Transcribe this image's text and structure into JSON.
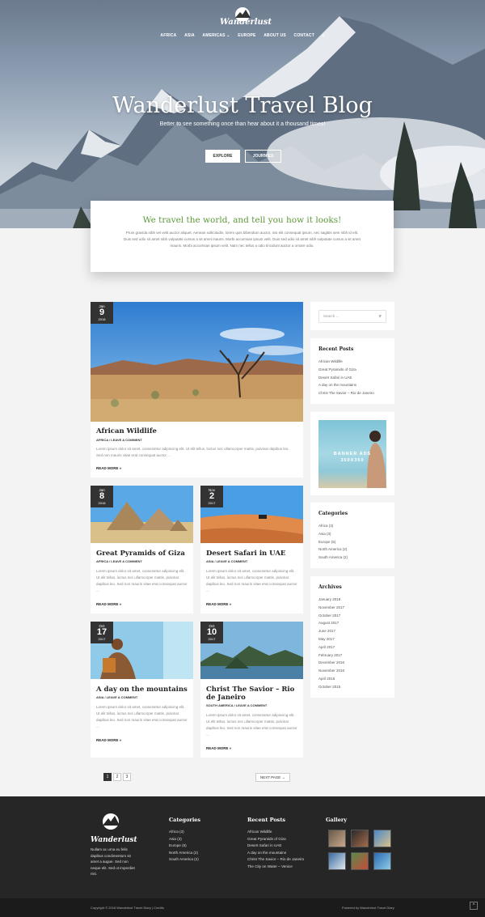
{
  "header": {
    "logo_text": "Wanderlust",
    "nav": [
      "AFRICA",
      "ASIA",
      "AMERICAS",
      "EUROPE",
      "ABOUT US",
      "CONTACT"
    ],
    "hero_title": "Wanderlust Travel Blog",
    "hero_subtitle": "Better to see something once than hear about it a thousand times!",
    "btn_explore": "EXPLORE",
    "btn_journeys": "JOURNIES"
  },
  "intro": {
    "title": "We travel the world, and tell you how it looks!",
    "text": "Proin gravida nibh vel velit auctor aliquet. Aenean sollicitudin, lorem quis bibendum auctor, nisi elit consequat ipsum, nec sagittis sem nibh id elit. Duis sed odio sit amet nibh vulputate cursus a sit amet mauris. Morbi accumsan ipsum velit. Duis sed odio sit amet nibh vulputate cursus a sit amet mauris. Morbi accumsan ipsum velit. Nam nec tellus a odio tincidunt auctor a ornare odio."
  },
  "posts": [
    {
      "month": "Jan",
      "day": "9",
      "year": "2018",
      "title": "African Wildlife",
      "meta": "AFRICA / LEAVE A COMMENT",
      "excerpt": "Lorem ipsum dolor sit amet, consectetur adipiscing elit. Ut elit tellus, luctus nec ullamcorper mattis, pulvinar dapibus leo. Sed non mauris vitae erat consequat auctor ...",
      "more": "READ MORE »"
    },
    {
      "month": "Jan",
      "day": "8",
      "year": "2018",
      "title": "Great Pyramids of Giza",
      "meta": "AFRICA / LEAVE A COMMENT",
      "excerpt": "Lorem ipsum dolor sit amet, consectetur adipiscing elit. Ut elit tellus, luctus nec ullamcorper mattis, pulvinar dapibus leo. Sed non mauris vitae erat consequat auctor ...",
      "more": "READ MORE »"
    },
    {
      "month": "Nov",
      "day": "2",
      "year": "2017",
      "title": "Desert Safari in UAE",
      "meta": "ASIA / LEAVE A COMMENT",
      "excerpt": "Lorem ipsum dolor sit amet, consectetur adipiscing elit. Ut elit tellus, luctus nec ullamcorper mattis, pulvinar dapibus leo. Sed non mauris vitae erat consequat auctor ...",
      "more": "READ MORE »"
    },
    {
      "month": "Oct",
      "day": "17",
      "year": "2017",
      "title": "A day on the mountains",
      "meta": "ASIA / LEAVE A COMMENT",
      "excerpt": "Lorem ipsum dolor sit amet, consectetur adipiscing elit. Ut elit tellus, luctus nec ullamcorper mattis, pulvinar dapibus leo. Sed non mauris vitae erat consequat auctor ...",
      "more": "READ MORE »"
    },
    {
      "month": "Oct",
      "day": "10",
      "year": "2017",
      "title": "Christ The Savior – Rio de Janeiro",
      "meta": "SOUTH AMERICA / LEAVE A COMMENT",
      "excerpt": "Lorem ipsum dolor sit amet, consectetur adipiscing elit. Ut elit tellus, luctus nec ullamcorper mattis, pulvinar dapibus leo. Sed non mauris vitae erat consequat auctor ...",
      "more": "READ MORE »"
    }
  ],
  "sidebar": {
    "search_placeholder": "Search ...",
    "recent_title": "Recent Posts",
    "recent": [
      "African Wildlife",
      "Great Pyramids of Giza",
      "Desert Safari in UAE",
      "A day on the mountains",
      "Christ The Savior – Rio de Janeiro"
    ],
    "banner_text": "BANNER ADS",
    "banner_size": "350X350",
    "categories_title": "Categories",
    "categories": [
      "Africa (3)",
      "Asia (3)",
      "Europe (5)",
      "North America (2)",
      "South America (2)"
    ],
    "archives_title": "Archives",
    "archives": [
      "January 2018",
      "November 2017",
      "October 2017",
      "August 2017",
      "June 2017",
      "May 2017",
      "April 2017",
      "February 2017",
      "December 2016",
      "November 2016",
      "April 2016",
      "October 2015"
    ]
  },
  "pagination": {
    "pages": [
      "1",
      "2",
      "3"
    ],
    "next": "NEXT PAGE →"
  },
  "footer": {
    "about": "Nullam ac urna eu felis dapibus condimentum sit amet a augue. Sed non neque elit. Sed ut imperdiet nisi.",
    "categories_title": "Categories",
    "categories": [
      "Africa (3)",
      "Asia (3)",
      "Europe (5)",
      "North America (2)",
      "South America (2)"
    ],
    "recent_title": "Recent Posts",
    "recent": [
      "African Wildlife",
      "Great Pyramids of Giza",
      "Desert Safari in UAE",
      "A day on the mountains",
      "Christ The Savior – Rio de Janeiro",
      "The City on Water – Venice"
    ],
    "gallery_title": "Gallery",
    "copyright": "Copyright © 2018 Wanderlust Travel Diary | Credits",
    "powered": "Powered by Wanderlust Travel Diary"
  }
}
